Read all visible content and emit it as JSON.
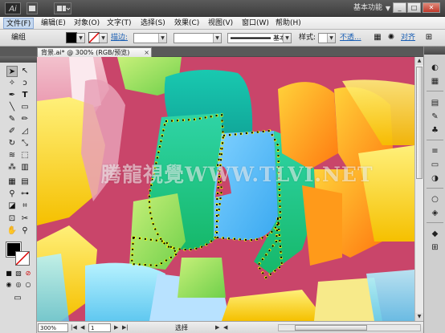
{
  "app": {
    "logo_text": "Ai",
    "workspace_label": "基本功能"
  },
  "menu": {
    "items": [
      "文件(F)",
      "编辑(E)",
      "对象(O)",
      "文字(T)",
      "选择(S)",
      "效果(C)",
      "视图(V)",
      "窗口(W)",
      "帮助(H)"
    ]
  },
  "control_bar": {
    "selection_label": "编组",
    "stroke_label": "描边:",
    "stroke_style": "基本",
    "style_label": "样式:",
    "opacity_link": "不透...",
    "align_label": "对齐"
  },
  "document": {
    "tab_title": "背景.ai* @ 300% (RGB/预览)",
    "close_symbol": "×"
  },
  "canvas": {
    "watermark": "腾龍視覺WWW.TLVI.NET",
    "background_color": "#c9456a"
  },
  "status": {
    "zoom": "300%",
    "page": "1",
    "tool_status": "选择"
  },
  "icons": {
    "tools": [
      "selection-tool-icon",
      "direct-selection-tool-icon",
      "magic-wand-icon",
      "lasso-icon",
      "pen-tool-icon",
      "type-tool-icon",
      "line-tool-icon",
      "rectangle-tool-icon",
      "paintbrush-icon",
      "pencil-icon",
      "blob-brush-icon",
      "eraser-icon",
      "rotate-icon",
      "scale-icon",
      "warp-icon",
      "free-transform-icon",
      "symbol-sprayer-icon",
      "column-graph-icon",
      "mesh-icon",
      "gradient-icon",
      "eyedropper-icon",
      "blend-icon",
      "live-paint-icon",
      "slice-icon",
      "artboard-icon",
      "scissors-icon",
      "hand-icon",
      "zoom-icon"
    ]
  }
}
